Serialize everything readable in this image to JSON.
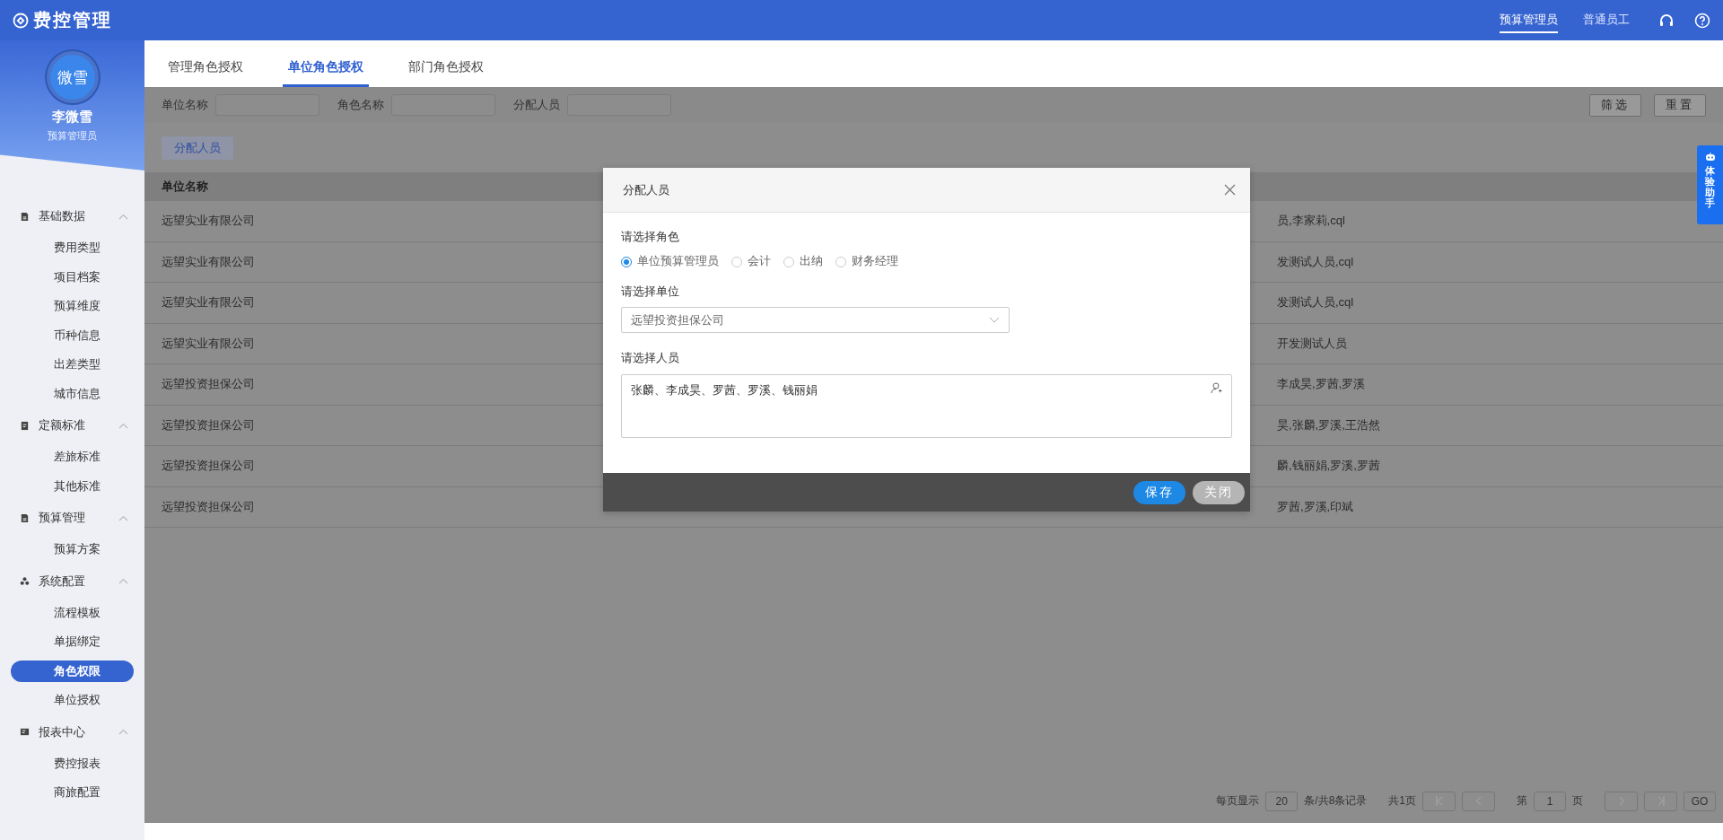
{
  "app": {
    "title": "费控管理"
  },
  "header": {
    "roles": [
      {
        "label": "预算管理员",
        "selected": true
      },
      {
        "label": "普通员工",
        "selected": false
      }
    ]
  },
  "user": {
    "avatar_text": "微雪",
    "name": "李微雪",
    "role": "预算管理员"
  },
  "sidebar": {
    "groups": [
      {
        "label": "基础数据",
        "kind": "doc",
        "expanded": true,
        "children": [
          {
            "label": "费用类型",
            "selected": false
          },
          {
            "label": "项目档案",
            "selected": false
          },
          {
            "label": "预算维度",
            "selected": false
          },
          {
            "label": "币种信息",
            "selected": false
          },
          {
            "label": "出差类型",
            "selected": false
          },
          {
            "label": "城市信息",
            "selected": false
          }
        ]
      },
      {
        "label": "定额标准",
        "kind": "note",
        "expanded": true,
        "children": [
          {
            "label": "差旅标准",
            "selected": false
          },
          {
            "label": "其他标准",
            "selected": false
          }
        ]
      },
      {
        "label": "预算管理",
        "kind": "doc",
        "expanded": true,
        "children": [
          {
            "label": "预算方案",
            "selected": false
          }
        ]
      },
      {
        "label": "系统配置",
        "kind": "nodes",
        "expanded": true,
        "children": [
          {
            "label": "流程模板",
            "selected": false
          },
          {
            "label": "单据绑定",
            "selected": false
          },
          {
            "label": "角色权限",
            "selected": true
          },
          {
            "label": "单位授权",
            "selected": false
          }
        ]
      },
      {
        "label": "报表中心",
        "kind": "report",
        "expanded": true,
        "children": [
          {
            "label": "费控报表",
            "selected": false
          },
          {
            "label": "商旅配置",
            "selected": false
          }
        ]
      }
    ]
  },
  "tabs": [
    {
      "label": "管理角色授权",
      "selected": false
    },
    {
      "label": "单位角色授权",
      "selected": true
    },
    {
      "label": "部门角色授权",
      "selected": false
    }
  ],
  "filters": [
    {
      "label": "单位名称"
    },
    {
      "label": "角色名称"
    },
    {
      "label": "分配人员"
    }
  ],
  "filter_buttons": [
    "筛选",
    "重置"
  ],
  "toolbar_button": "分配人员",
  "table": {
    "columns": [
      "单位名称"
    ],
    "rows": [
      {
        "unit": "远望实业有限公司",
        "persons": "员,李家莉,cql"
      },
      {
        "unit": "远望实业有限公司",
        "persons": "发测试人员,cql"
      },
      {
        "unit": "远望实业有限公司",
        "persons": "发测试人员,cql"
      },
      {
        "unit": "远望实业有限公司",
        "persons": "开发测试人员"
      },
      {
        "unit": "远望投资担保公司",
        "persons": "李成昊,罗茜,罗溪"
      },
      {
        "unit": "远望投资担保公司",
        "persons": "昊,张麟,罗溪,王浩然"
      },
      {
        "unit": "远望投资担保公司",
        "persons": "麟,钱丽娟,罗溪,罗茜"
      },
      {
        "unit": "远望投资担保公司",
        "persons": "罗茜,罗溪,印斌"
      }
    ]
  },
  "pagination": {
    "per_page_label": "每页显示",
    "per_page": "20",
    "summary": "条/共8条记录",
    "pages": "共1页",
    "page_prefix": "第",
    "page": "1",
    "page_suffix": "页",
    "go": "GO"
  },
  "dialog": {
    "title": "分配人员",
    "role_label": "请选择角色",
    "roles": [
      {
        "label": "单位预算管理员",
        "selected": true
      },
      {
        "label": "会计",
        "selected": false
      },
      {
        "label": "出纳",
        "selected": false
      },
      {
        "label": "财务经理",
        "selected": false
      }
    ],
    "unit_label": "请选择单位",
    "unit_value": "远望投资担保公司",
    "people_label": "请选择人员",
    "people_value": "张麟、李成昊、罗茜、罗溪、钱丽娟",
    "buttons": [
      {
        "label": "保存",
        "kind": "primary"
      },
      {
        "label": "关闭",
        "kind": "secondary"
      }
    ]
  },
  "assistant": {
    "label": "体验助手"
  }
}
